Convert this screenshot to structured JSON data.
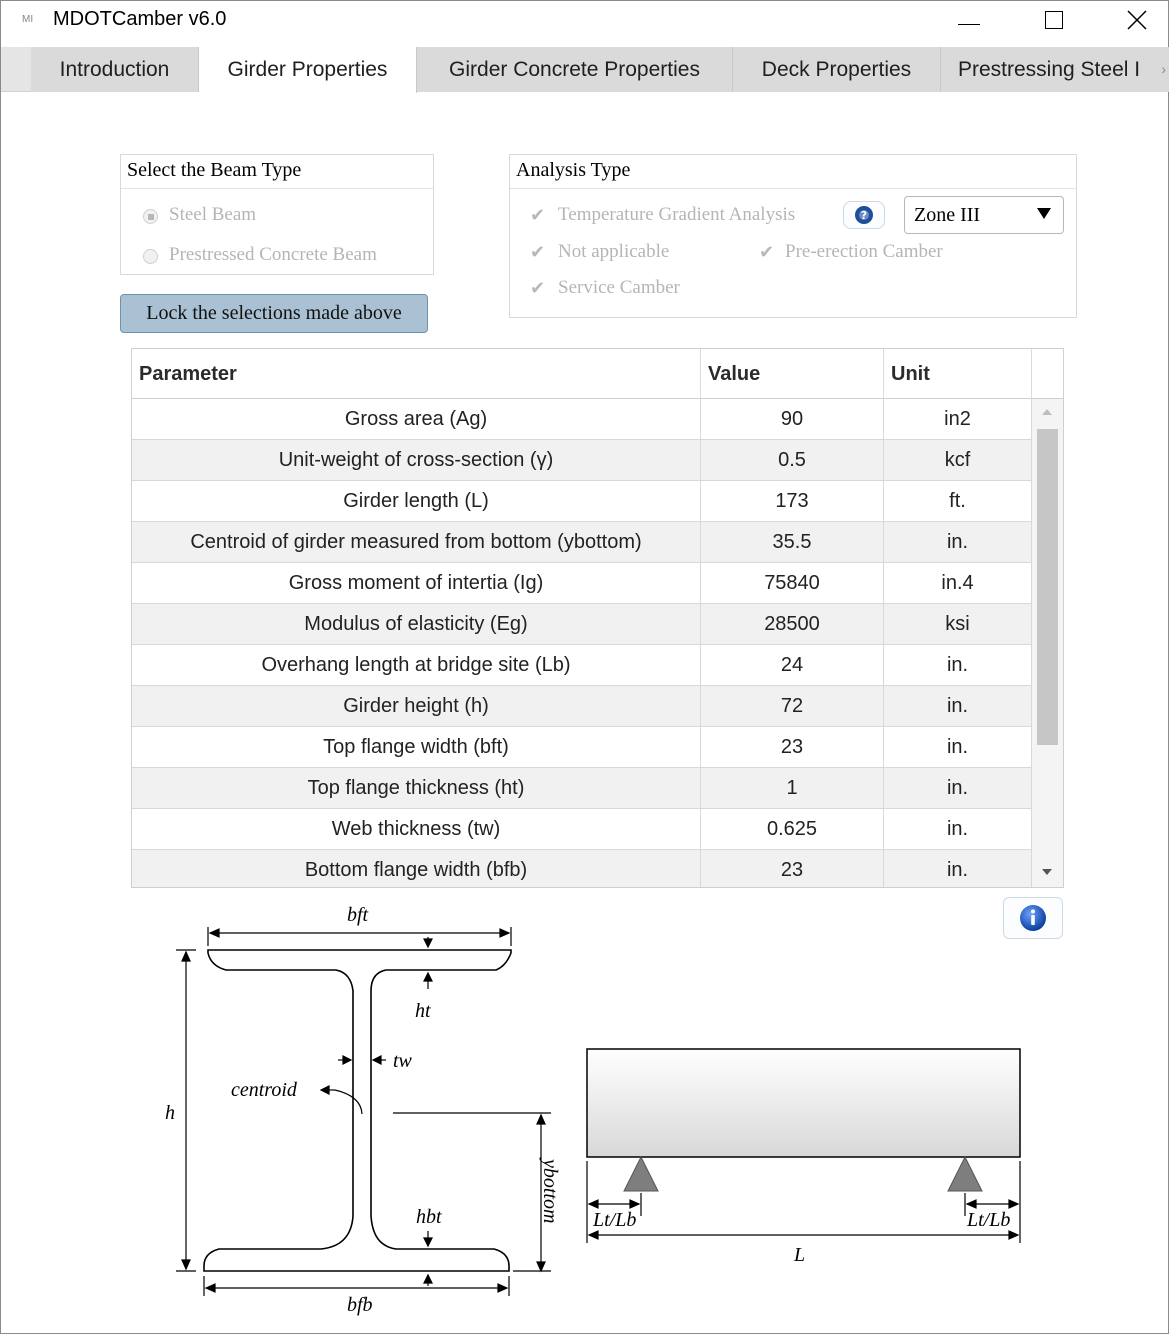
{
  "window": {
    "app_icon": "MI",
    "title": "MDOTCamber v6.0"
  },
  "tabs": [
    {
      "label": "Introduction"
    },
    {
      "label": "Girder Properties"
    },
    {
      "label": "Girder Concrete Properties"
    },
    {
      "label": "Deck Properties"
    },
    {
      "label": "Prestressing Steel I"
    }
  ],
  "beam_type": {
    "title": "Select the Beam Type",
    "options": [
      "Steel Beam",
      "Prestressed Concrete Beam"
    ],
    "selected": "Steel Beam"
  },
  "analysis_type": {
    "title": "Analysis Type",
    "options": [
      "Temperature Gradient Analysis",
      "Not applicable",
      "Pre-erection Camber",
      "Service Camber"
    ],
    "zone": "Zone III"
  },
  "lock_button": "Lock the selections made above",
  "table": {
    "headers": [
      "Parameter",
      "Value",
      "Unit"
    ],
    "rows": [
      [
        "Gross area (Ag)",
        "90",
        "in2"
      ],
      [
        "Unit-weight of cross-section (γ)",
        "0.5",
        "kcf"
      ],
      [
        "Girder length (L)",
        "173",
        "ft."
      ],
      [
        "Centroid of girder measured from bottom (ybottom)",
        "35.5",
        "in."
      ],
      [
        "Gross moment of intertia (Ig)",
        "75840",
        "in.4"
      ],
      [
        "Modulus of elasticity (Eg)",
        "28500",
        "ksi"
      ],
      [
        "Overhang length at bridge site (Lb)",
        "24",
        "in."
      ],
      [
        "Girder height (h)",
        "72",
        "in."
      ],
      [
        "Top flange width (bft)",
        "23",
        "in."
      ],
      [
        "Top flange thickness (ht)",
        "1",
        "in."
      ],
      [
        "Web thickness (tw)",
        "0.625",
        "in."
      ],
      [
        "Bottom flange width (bfb)",
        "23",
        "in."
      ]
    ]
  },
  "diagram_labels": {
    "bft": "bft",
    "ht": "ht",
    "tw": "tw",
    "centroid": "centroid",
    "h": "h",
    "ybottom": "ybottom",
    "hbt": "hbt",
    "bfb": "bfb",
    "support_left": "Lt/Lb",
    "support_right": "Lt/Lb",
    "span": "L"
  },
  "icons": {
    "minimize": "minimize-icon",
    "maximize": "maximize-icon",
    "close": "close-icon",
    "help": "help-icon",
    "info": "info-icon"
  }
}
